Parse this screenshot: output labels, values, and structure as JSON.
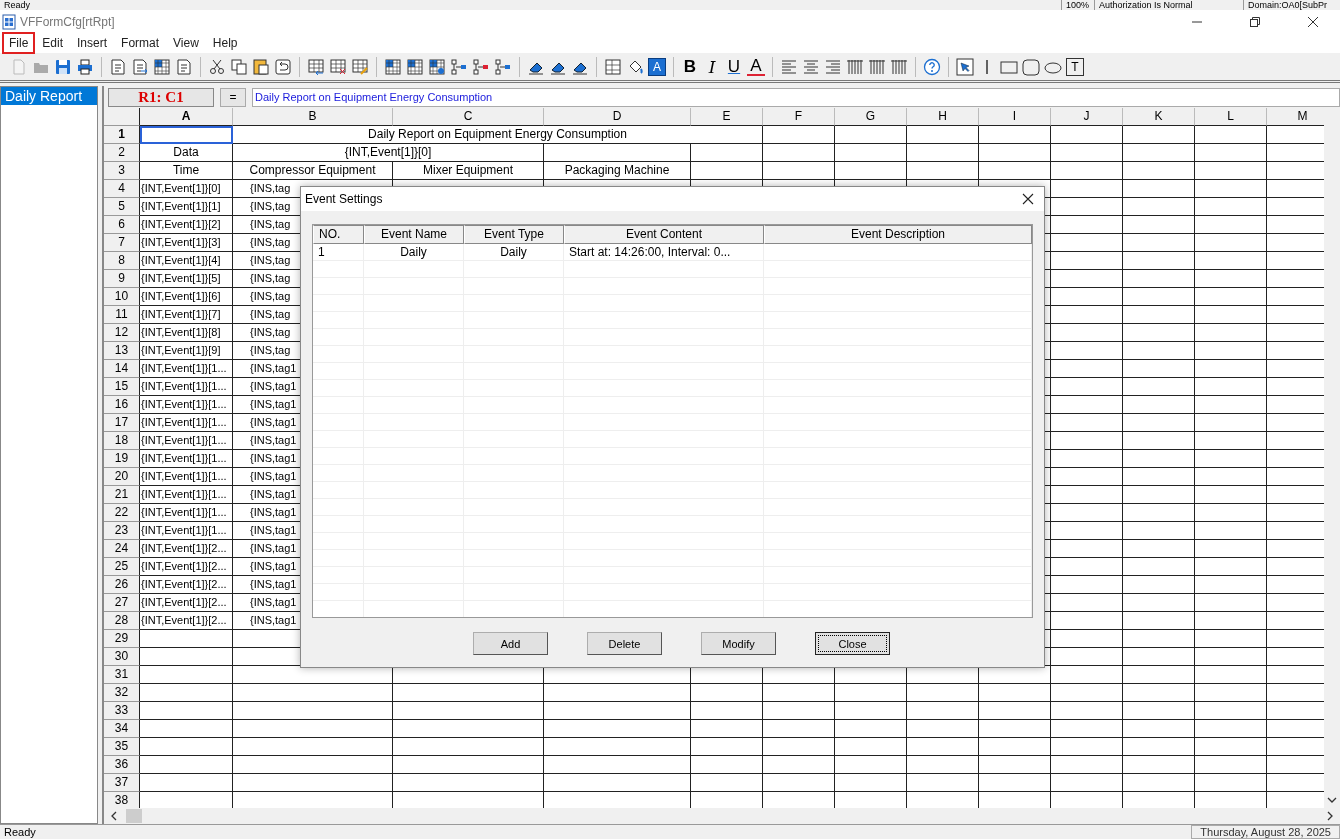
{
  "top_strip": {
    "status": "Ready",
    "zoom": "100%",
    "authorization": "Authorization Is Normal",
    "domain": "Domain:OA0[SubPr"
  },
  "window": {
    "title": "VFFormCfg[rtRpt]"
  },
  "menu": [
    {
      "label": "File",
      "highlighted": true
    },
    {
      "label": "Edit",
      "highlighted": false
    },
    {
      "label": "Insert",
      "highlighted": false
    },
    {
      "label": "Format",
      "highlighted": false
    },
    {
      "label": "View",
      "highlighted": false
    },
    {
      "label": "Help",
      "highlighted": false
    }
  ],
  "toolbar": {
    "font_color": "A",
    "format_buttons": [
      {
        "label": "B",
        "kind": "bold"
      },
      {
        "label": "I",
        "kind": "italic"
      },
      {
        "label": "U",
        "kind": "underline"
      },
      {
        "label": "A",
        "kind": "strike"
      }
    ],
    "text_tool": "T"
  },
  "sidebar": {
    "items": [
      {
        "label": "Daily Report",
        "selected": true
      }
    ]
  },
  "formula_bar": {
    "cell_ref": "R1: C1",
    "equals": "=",
    "value": "Daily Report on Equipment Energy Consumption"
  },
  "sheet": {
    "columns": [
      "A",
      "B",
      "C",
      "D",
      "E",
      "F",
      "G",
      "H",
      "I",
      "J",
      "K",
      "L",
      "M"
    ],
    "rows": [
      {
        "number": "1",
        "cells": [
          {
            "selected": true
          },
          {
            "text": "Daily Report on Equipment Energy Consumption",
            "selected": false
          }
        ]
      },
      {
        "number": "2",
        "cells": [
          {
            "text": "Data",
            "selected": false
          },
          {
            "text": "{INT,Event[1]}[0]",
            "selected": false
          }
        ]
      },
      {
        "number": "3",
        "cells": [
          {
            "text": "Time",
            "selected": false
          },
          {
            "text": "Compressor Equipment",
            "selected": false
          },
          {
            "text": "Mixer Equipment",
            "selected": false
          },
          {
            "text": "Packaging Machine",
            "selected": false
          }
        ]
      },
      {
        "number": "4",
        "kind": "data",
        "cells": [
          {
            "text": "{INT,Event[1]}[0]",
            "selected": false
          },
          {
            "text": "{INS,tag",
            "selected": false
          }
        ]
      },
      {
        "number": "5",
        "kind": "data",
        "cells": [
          {
            "text": "{INT,Event[1]}[1]",
            "selected": false
          },
          {
            "text": "{INS,tag",
            "selected": false
          }
        ]
      },
      {
        "number": "6",
        "kind": "data",
        "cells": [
          {
            "text": "{INT,Event[1]}[2]",
            "selected": false
          },
          {
            "text": "{INS,tag",
            "selected": false
          }
        ]
      },
      {
        "number": "7",
        "kind": "data",
        "cells": [
          {
            "text": "{INT,Event[1]}[3]",
            "selected": false
          },
          {
            "text": "{INS,tag",
            "selected": false
          }
        ]
      },
      {
        "number": "8",
        "kind": "data",
        "cells": [
          {
            "text": "{INT,Event[1]}[4]",
            "selected": false
          },
          {
            "text": "{INS,tag",
            "selected": false
          }
        ]
      },
      {
        "number": "9",
        "kind": "data",
        "cells": [
          {
            "text": "{INT,Event[1]}[5]",
            "selected": false
          },
          {
            "text": "{INS,tag",
            "selected": false
          }
        ]
      },
      {
        "number": "10",
        "kind": "data",
        "cells": [
          {
            "text": "{INT,Event[1]}[6]",
            "selected": false
          },
          {
            "text": "{INS,tag",
            "selected": false
          }
        ]
      },
      {
        "number": "11",
        "kind": "data",
        "cells": [
          {
            "text": "{INT,Event[1]}[7]",
            "selected": false
          },
          {
            "text": "{INS,tag",
            "selected": false
          }
        ]
      },
      {
        "number": "12",
        "kind": "data",
        "cells": [
          {
            "text": "{INT,Event[1]}[8]",
            "selected": false
          },
          {
            "text": "{INS,tag",
            "selected": false
          }
        ]
      },
      {
        "number": "13",
        "kind": "data",
        "cells": [
          {
            "text": "{INT,Event[1]}[9]",
            "selected": false
          },
          {
            "text": "{INS,tag",
            "selected": false
          }
        ]
      },
      {
        "number": "14",
        "kind": "data",
        "cells": [
          {
            "text": "{INT,Event[1]}[1...",
            "selected": false
          },
          {
            "text": "{INS,tag1",
            "selected": false
          }
        ]
      },
      {
        "number": "15",
        "kind": "data",
        "cells": [
          {
            "text": "{INT,Event[1]}[1...",
            "selected": false
          },
          {
            "text": "{INS,tag1",
            "selected": false
          }
        ]
      },
      {
        "number": "16",
        "kind": "data",
        "cells": [
          {
            "text": "{INT,Event[1]}[1...",
            "selected": false
          },
          {
            "text": "{INS,tag1",
            "selected": false
          }
        ]
      },
      {
        "number": "17",
        "kind": "data",
        "cells": [
          {
            "text": "{INT,Event[1]}[1...",
            "selected": false
          },
          {
            "text": "{INS,tag1",
            "selected": false
          }
        ]
      },
      {
        "number": "18",
        "kind": "data",
        "cells": [
          {
            "text": "{INT,Event[1]}[1...",
            "selected": false
          },
          {
            "text": "{INS,tag1",
            "selected": false
          }
        ]
      },
      {
        "number": "19",
        "kind": "data",
        "cells": [
          {
            "text": "{INT,Event[1]}[1...",
            "selected": false
          },
          {
            "text": "{INS,tag1",
            "selected": false
          }
        ]
      },
      {
        "number": "20",
        "kind": "data",
        "cells": [
          {
            "text": "{INT,Event[1]}[1...",
            "selected": false
          },
          {
            "text": "{INS,tag1",
            "selected": false
          }
        ]
      },
      {
        "number": "21",
        "kind": "data",
        "cells": [
          {
            "text": "{INT,Event[1]}[1...",
            "selected": false
          },
          {
            "text": "{INS,tag1",
            "selected": false
          }
        ]
      },
      {
        "number": "22",
        "kind": "data",
        "cells": [
          {
            "text": "{INT,Event[1]}[1...",
            "selected": false
          },
          {
            "text": "{INS,tag1",
            "selected": false
          }
        ]
      },
      {
        "number": "23",
        "kind": "data",
        "cells": [
          {
            "text": "{INT,Event[1]}[1...",
            "selected": false
          },
          {
            "text": "{INS,tag1",
            "selected": false
          }
        ]
      },
      {
        "number": "24",
        "kind": "data",
        "cells": [
          {
            "text": "{INT,Event[1]}[2...",
            "selected": false
          },
          {
            "text": "{INS,tag1",
            "selected": false
          }
        ]
      },
      {
        "number": "25",
        "kind": "data",
        "cells": [
          {
            "text": "{INT,Event[1]}[2...",
            "selected": false
          },
          {
            "text": "{INS,tag1",
            "selected": false
          }
        ]
      },
      {
        "number": "26",
        "kind": "data",
        "cells": [
          {
            "text": "{INT,Event[1]}[2...",
            "selected": false
          },
          {
            "text": "{INS,tag1",
            "selected": false
          }
        ]
      },
      {
        "number": "27",
        "kind": "data",
        "cells": [
          {
            "text": "{INT,Event[1]}[2...",
            "selected": false
          },
          {
            "text": "{INS,tag1",
            "selected": false
          }
        ]
      },
      {
        "number": "28",
        "kind": "data",
        "cells": [
          {
            "text": "{INT,Event[1]}[2...",
            "selected": false
          },
          {
            "text": "{INS,tag1",
            "selected": false
          }
        ]
      },
      {
        "number": "29"
      },
      {
        "number": "30"
      },
      {
        "number": "31"
      },
      {
        "number": "32"
      },
      {
        "number": "33"
      },
      {
        "number": "34"
      },
      {
        "number": "35"
      },
      {
        "number": "36"
      },
      {
        "number": "37"
      },
      {
        "number": "38"
      }
    ]
  },
  "dialog": {
    "title": "Event Settings",
    "table": {
      "columns": [
        "NO.",
        "Event Name",
        "Event Type",
        "Event Content",
        "Event Description"
      ],
      "rows": [
        {
          "no": "1",
          "name": "Daily",
          "type": "Daily",
          "content": "Start at: 14:26:00, Interval: 0..."
        }
      ]
    },
    "buttons": [
      {
        "label": "Add",
        "focused": false
      },
      {
        "label": "Delete",
        "focused": false
      },
      {
        "label": "Modify",
        "focused": false
      },
      {
        "label": "Close",
        "focused": true
      }
    ]
  },
  "status_bar": {
    "status": "Ready",
    "date": "Thursday, August 28, 2025"
  }
}
